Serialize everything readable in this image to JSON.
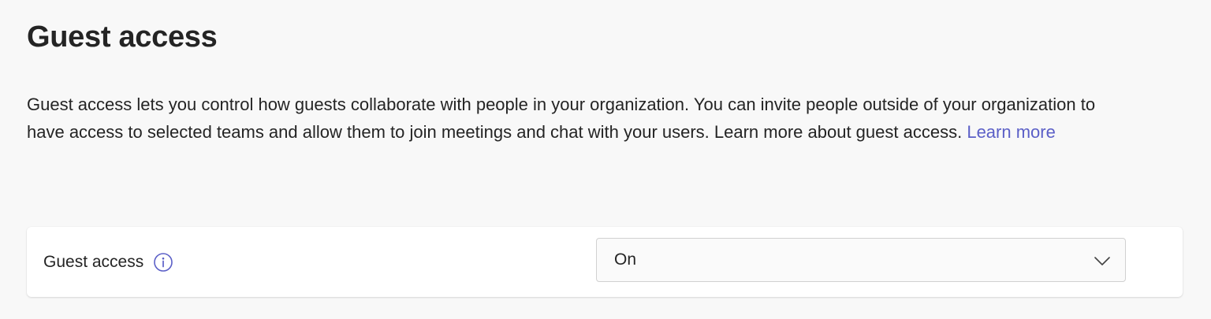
{
  "page": {
    "title": "Guest access",
    "description": "Guest access lets you control how guests collaborate with people in your organization. You can invite people outside of your organization to have access to selected teams and allow them to join meetings and chat with your users. Learn more about guest access.",
    "learn_more_link": "Learn more"
  },
  "setting": {
    "label": "Guest access",
    "info_icon": "info-icon",
    "dropdown": {
      "selected_value": "On",
      "icon": "chevron-down-icon"
    }
  },
  "colors": {
    "background": "#f8f8f8",
    "card": "#ffffff",
    "link": "#5b5fc7",
    "text": "#242424"
  }
}
